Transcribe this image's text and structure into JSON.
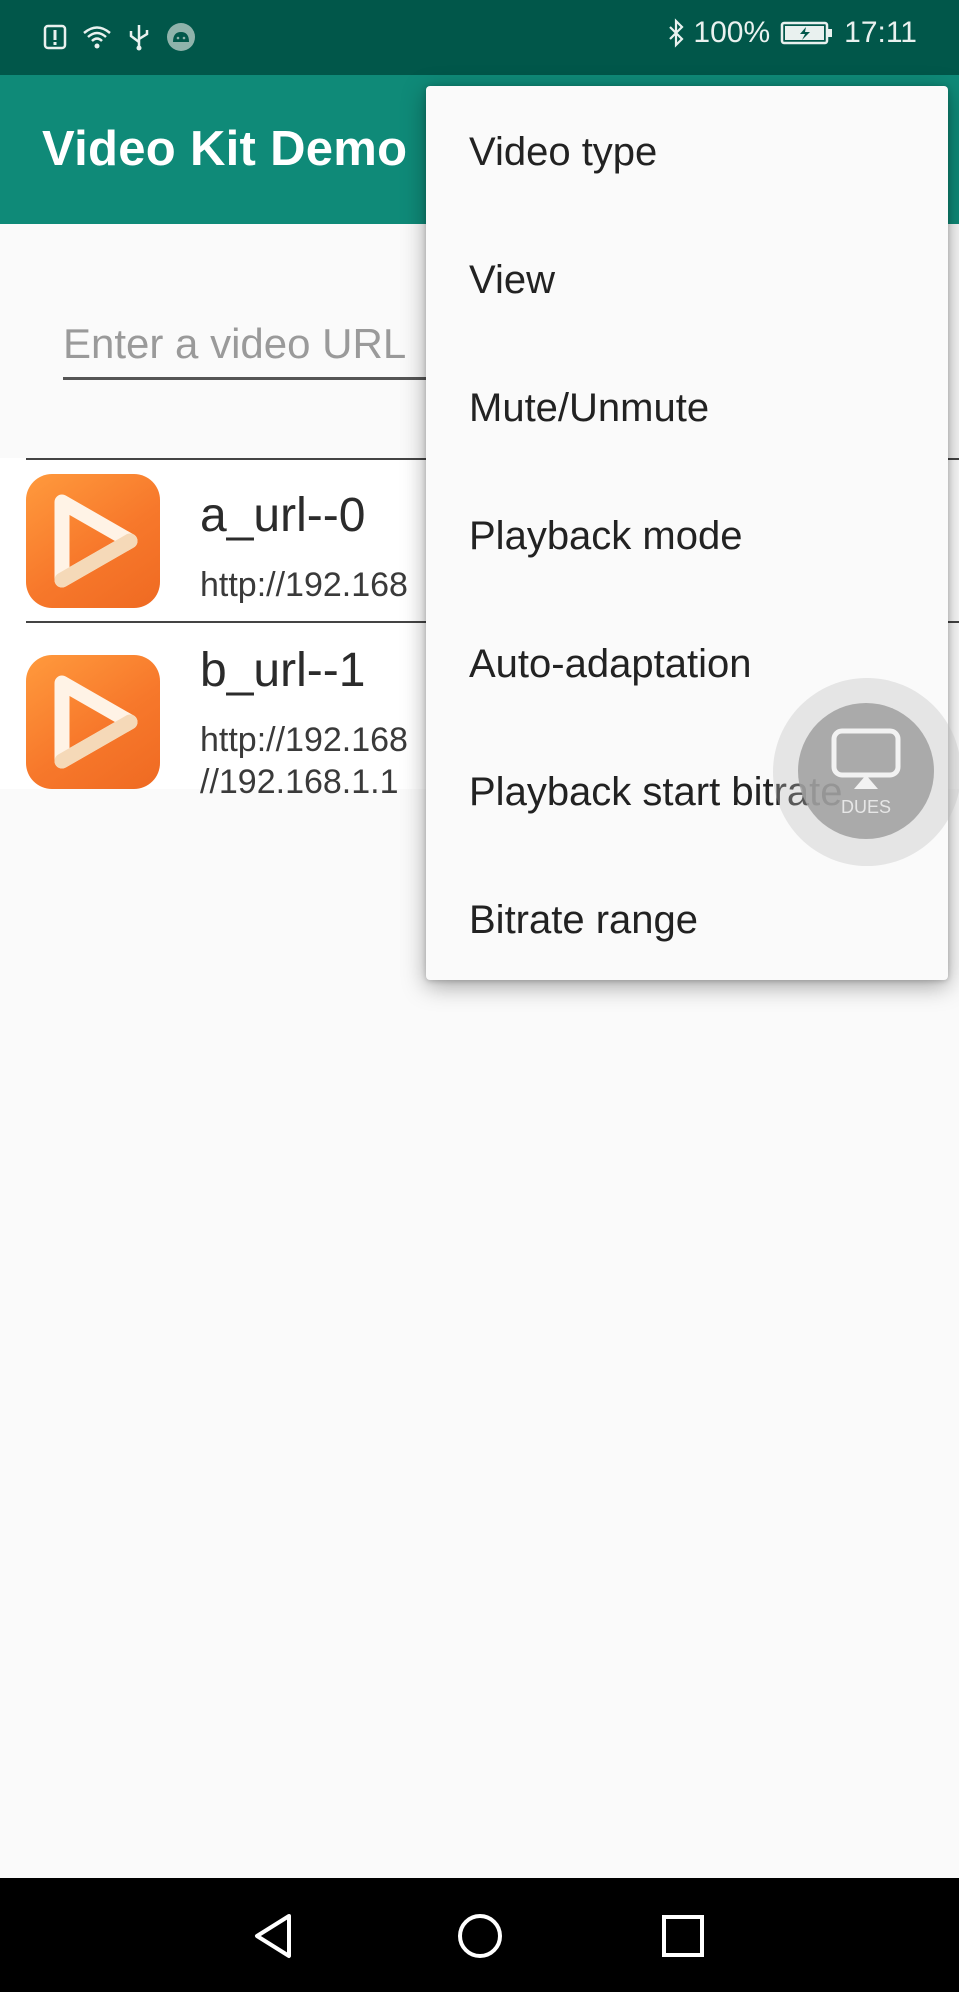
{
  "status_bar": {
    "battery": "100%",
    "time": "17:11",
    "icons": [
      "alert-icon",
      "wifi-icon",
      "usb-icon",
      "android-icon",
      "bluetooth-icon",
      "battery-charging-icon"
    ]
  },
  "app_bar": {
    "title": "Video Kit Demo"
  },
  "search": {
    "placeholder": "Enter a video URL"
  },
  "videos": [
    {
      "title": "a_url--0",
      "url": "http://192.168"
    },
    {
      "title": "b_url--1",
      "url": "http://192.168\n//192.168.1.1"
    }
  ],
  "menu": {
    "items": [
      "Video type",
      "View",
      "Mute/Unmute",
      "Playback mode",
      "Auto-adaptation",
      "Playback start bitrate",
      "Bitrate range"
    ]
  },
  "floating_button": {
    "label": "DUES",
    "icon": "screen-cast-icon"
  },
  "nav_bar": {
    "buttons": [
      "back-icon",
      "home-icon",
      "recents-icon"
    ]
  },
  "colors": {
    "status_bar": "#01574a",
    "app_bar": "#0f8a78",
    "thumb_orange": "#f7782b"
  }
}
